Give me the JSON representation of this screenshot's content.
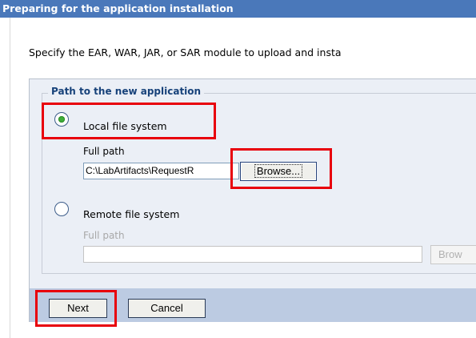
{
  "title": "Preparing for the application installation",
  "instruction": "Specify the EAR, WAR, JAR, or SAR module to upload and insta",
  "path_group": {
    "legend": "Path to the new application",
    "local": {
      "label": "Local file system",
      "selected": true,
      "full_path_label": "Full path",
      "full_path_value": "C:\\LabArtifacts\\RequestR",
      "browse_label": "Browse..."
    },
    "remote": {
      "label": "Remote file system",
      "selected": false,
      "full_path_label": "Full path",
      "full_path_value": "",
      "browse_label": "Brow"
    }
  },
  "buttons": {
    "next": "Next",
    "cancel": "Cancel"
  },
  "colors": {
    "title_bar": "#4a78ba",
    "panel_bg": "#ebeff6",
    "footer_bg": "#bccbe2",
    "highlight": "#e8000b",
    "radio_selected": "#3fae3a"
  }
}
